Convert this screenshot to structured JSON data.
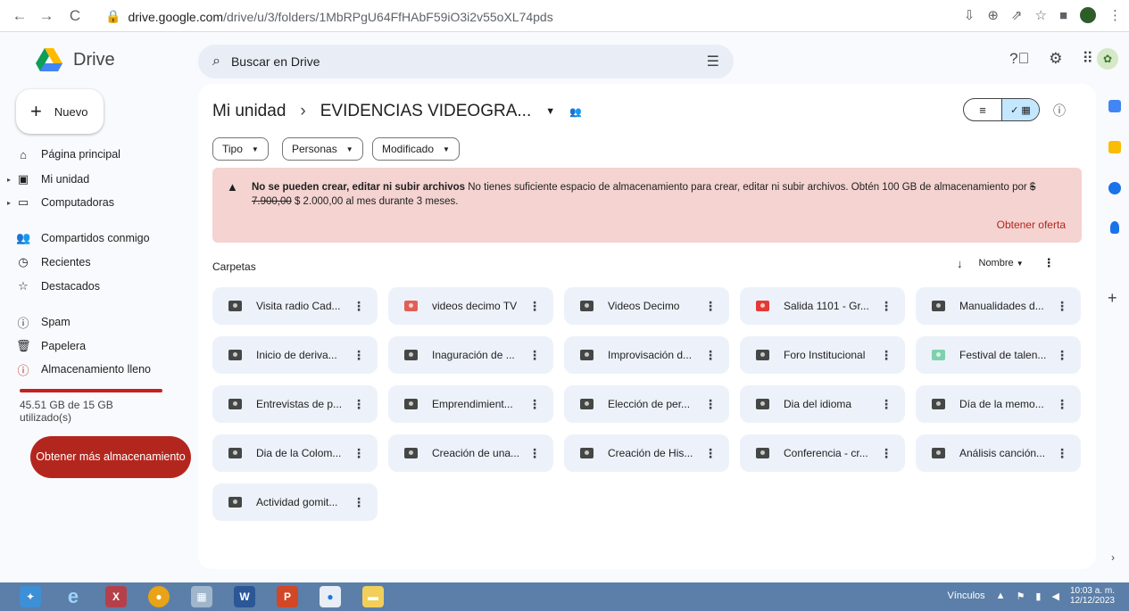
{
  "browser": {
    "url_domain": "drive.google.com",
    "url_path": "/drive/u/3/folders/1MbRPgU64FfHAbF59iO3i2v55oXL74pds"
  },
  "app": {
    "name": "Drive",
    "search_placeholder": "Buscar en Drive"
  },
  "sidebar": {
    "new_label": "Nuevo",
    "items": [
      {
        "label": "Página principal",
        "icon": "home-icon"
      },
      {
        "label": "Mi unidad",
        "icon": "drive-icon"
      },
      {
        "label": "Computadoras",
        "icon": "computer-icon"
      },
      {
        "label": "Compartidos conmigo",
        "icon": "people-icon"
      },
      {
        "label": "Recientes",
        "icon": "clock-icon"
      },
      {
        "label": "Destacados",
        "icon": "star-icon"
      },
      {
        "label": "Spam",
        "icon": "spam-icon"
      },
      {
        "label": "Papelera",
        "icon": "trash-icon"
      },
      {
        "label": "Almacenamiento lleno",
        "icon": "storage-warning-icon"
      }
    ],
    "storage_text": "45.51 GB de 15 GB utilizado(s)",
    "get_more_label": "Obtener más almacenamiento"
  },
  "breadcrumb": {
    "root": "Mi unidad",
    "current": "EVIDENCIAS VIDEOGRA..."
  },
  "filters": [
    "Tipo",
    "Personas",
    "Modificado"
  ],
  "banner": {
    "title": "No se pueden crear, editar ni subir archivos",
    "body": " No tienes suficiente espacio de almacenamiento para crear, editar ni subir archivos. Obtén 100 GB de almacenamiento por ",
    "old_price": "$ 7.900,00",
    "new_price": " $ 2.000,00 al mes durante 3 meses.",
    "action": "Obtener oferta"
  },
  "section_label": "Carpetas",
  "sort_label": "Nombre",
  "folders": [
    {
      "name": "Visita radio Cad...",
      "color": "#444746"
    },
    {
      "name": "videos decimo TV",
      "color": "#e06055"
    },
    {
      "name": "Videos Decimo",
      "color": "#444746"
    },
    {
      "name": "Salida 1101 - Gr...",
      "color": "#e53935"
    },
    {
      "name": "Manualidades d...",
      "color": "#444746"
    },
    {
      "name": "Inicio de deriva...",
      "color": "#444746"
    },
    {
      "name": "Inaguración de ...",
      "color": "#444746"
    },
    {
      "name": "Improvisación d...",
      "color": "#444746"
    },
    {
      "name": "Foro Institucional",
      "color": "#444746"
    },
    {
      "name": "Festival de talen...",
      "color": "#7fd1ae"
    },
    {
      "name": "Entrevistas de p...",
      "color": "#444746"
    },
    {
      "name": "Emprendimient...",
      "color": "#444746"
    },
    {
      "name": "Elección de per...",
      "color": "#444746"
    },
    {
      "name": "Dia del idioma",
      "color": "#444746"
    },
    {
      "name": "Día de la memo...",
      "color": "#444746"
    },
    {
      "name": "Dia de la Colom...",
      "color": "#444746"
    },
    {
      "name": "Creación de una...",
      "color": "#444746"
    },
    {
      "name": "Creación de His...",
      "color": "#444746"
    },
    {
      "name": "Conferencia - cr...",
      "color": "#444746"
    },
    {
      "name": "Análisis canción...",
      "color": "#444746"
    },
    {
      "name": "Actividad gomit...",
      "color": "#444746"
    }
  ],
  "taskbar": {
    "links_label": "Vínculos",
    "time": "10:03 a. m.",
    "date": "12/12/2023"
  }
}
